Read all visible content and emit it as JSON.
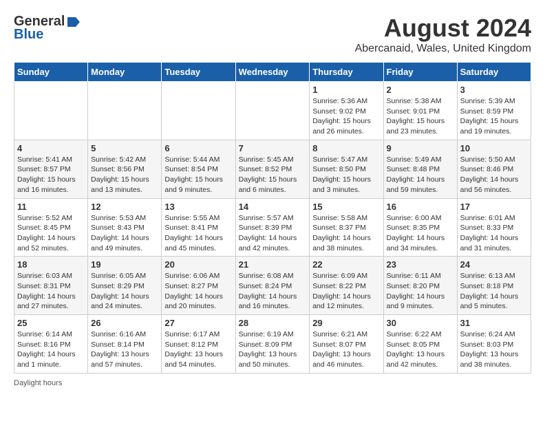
{
  "header": {
    "logo_general": "General",
    "logo_blue": "Blue",
    "month_title": "August 2024",
    "location": "Abercanaid, Wales, United Kingdom"
  },
  "weekdays": [
    "Sunday",
    "Monday",
    "Tuesday",
    "Wednesday",
    "Thursday",
    "Friday",
    "Saturday"
  ],
  "weeks": [
    [
      {
        "day": "",
        "info": ""
      },
      {
        "day": "",
        "info": ""
      },
      {
        "day": "",
        "info": ""
      },
      {
        "day": "",
        "info": ""
      },
      {
        "day": "1",
        "info": "Sunrise: 5:36 AM\nSunset: 9:02 PM\nDaylight: 15 hours\nand 26 minutes."
      },
      {
        "day": "2",
        "info": "Sunrise: 5:38 AM\nSunset: 9:01 PM\nDaylight: 15 hours\nand 23 minutes."
      },
      {
        "day": "3",
        "info": "Sunrise: 5:39 AM\nSunset: 8:59 PM\nDaylight: 15 hours\nand 19 minutes."
      }
    ],
    [
      {
        "day": "4",
        "info": "Sunrise: 5:41 AM\nSunset: 8:57 PM\nDaylight: 15 hours\nand 16 minutes."
      },
      {
        "day": "5",
        "info": "Sunrise: 5:42 AM\nSunset: 8:56 PM\nDaylight: 15 hours\nand 13 minutes."
      },
      {
        "day": "6",
        "info": "Sunrise: 5:44 AM\nSunset: 8:54 PM\nDaylight: 15 hours\nand 9 minutes."
      },
      {
        "day": "7",
        "info": "Sunrise: 5:45 AM\nSunset: 8:52 PM\nDaylight: 15 hours\nand 6 minutes."
      },
      {
        "day": "8",
        "info": "Sunrise: 5:47 AM\nSunset: 8:50 PM\nDaylight: 15 hours\nand 3 minutes."
      },
      {
        "day": "9",
        "info": "Sunrise: 5:49 AM\nSunset: 8:48 PM\nDaylight: 14 hours\nand 59 minutes."
      },
      {
        "day": "10",
        "info": "Sunrise: 5:50 AM\nSunset: 8:46 PM\nDaylight: 14 hours\nand 56 minutes."
      }
    ],
    [
      {
        "day": "11",
        "info": "Sunrise: 5:52 AM\nSunset: 8:45 PM\nDaylight: 14 hours\nand 52 minutes."
      },
      {
        "day": "12",
        "info": "Sunrise: 5:53 AM\nSunset: 8:43 PM\nDaylight: 14 hours\nand 49 minutes."
      },
      {
        "day": "13",
        "info": "Sunrise: 5:55 AM\nSunset: 8:41 PM\nDaylight: 14 hours\nand 45 minutes."
      },
      {
        "day": "14",
        "info": "Sunrise: 5:57 AM\nSunset: 8:39 PM\nDaylight: 14 hours\nand 42 minutes."
      },
      {
        "day": "15",
        "info": "Sunrise: 5:58 AM\nSunset: 8:37 PM\nDaylight: 14 hours\nand 38 minutes."
      },
      {
        "day": "16",
        "info": "Sunrise: 6:00 AM\nSunset: 8:35 PM\nDaylight: 14 hours\nand 34 minutes."
      },
      {
        "day": "17",
        "info": "Sunrise: 6:01 AM\nSunset: 8:33 PM\nDaylight: 14 hours\nand 31 minutes."
      }
    ],
    [
      {
        "day": "18",
        "info": "Sunrise: 6:03 AM\nSunset: 8:31 PM\nDaylight: 14 hours\nand 27 minutes."
      },
      {
        "day": "19",
        "info": "Sunrise: 6:05 AM\nSunset: 8:29 PM\nDaylight: 14 hours\nand 24 minutes."
      },
      {
        "day": "20",
        "info": "Sunrise: 6:06 AM\nSunset: 8:27 PM\nDaylight: 14 hours\nand 20 minutes."
      },
      {
        "day": "21",
        "info": "Sunrise: 6:08 AM\nSunset: 8:24 PM\nDaylight: 14 hours\nand 16 minutes."
      },
      {
        "day": "22",
        "info": "Sunrise: 6:09 AM\nSunset: 8:22 PM\nDaylight: 14 hours\nand 12 minutes."
      },
      {
        "day": "23",
        "info": "Sunrise: 6:11 AM\nSunset: 8:20 PM\nDaylight: 14 hours\nand 9 minutes."
      },
      {
        "day": "24",
        "info": "Sunrise: 6:13 AM\nSunset: 8:18 PM\nDaylight: 14 hours\nand 5 minutes."
      }
    ],
    [
      {
        "day": "25",
        "info": "Sunrise: 6:14 AM\nSunset: 8:16 PM\nDaylight: 14 hours\nand 1 minute."
      },
      {
        "day": "26",
        "info": "Sunrise: 6:16 AM\nSunset: 8:14 PM\nDaylight: 13 hours\nand 57 minutes."
      },
      {
        "day": "27",
        "info": "Sunrise: 6:17 AM\nSunset: 8:12 PM\nDaylight: 13 hours\nand 54 minutes."
      },
      {
        "day": "28",
        "info": "Sunrise: 6:19 AM\nSunset: 8:09 PM\nDaylight: 13 hours\nand 50 minutes."
      },
      {
        "day": "29",
        "info": "Sunrise: 6:21 AM\nSunset: 8:07 PM\nDaylight: 13 hours\nand 46 minutes."
      },
      {
        "day": "30",
        "info": "Sunrise: 6:22 AM\nSunset: 8:05 PM\nDaylight: 13 hours\nand 42 minutes."
      },
      {
        "day": "31",
        "info": "Sunrise: 6:24 AM\nSunset: 8:03 PM\nDaylight: 13 hours\nand 38 minutes."
      }
    ]
  ],
  "footer": {
    "note": "Daylight hours"
  }
}
